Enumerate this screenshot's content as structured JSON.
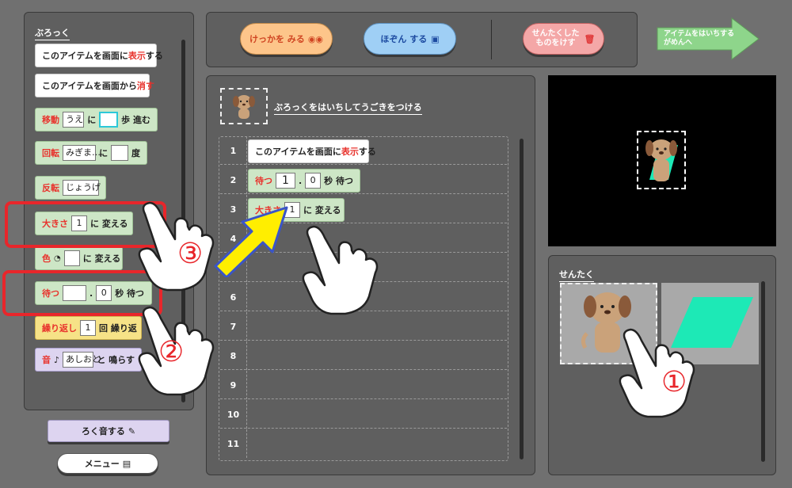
{
  "palette": {
    "label": "ぶろっく",
    "show_block": {
      "pre": "このアイテムを画面に",
      "accent": "表示",
      "post": "する"
    },
    "hide_block": {
      "pre": "このアイテムを画面から",
      "accent": "消す"
    },
    "move_block": {
      "accent": "移動",
      "dir": "うえ",
      "p1": "に",
      "value": "",
      "p2": "歩 進む"
    },
    "rotate_block": {
      "accent": "回転",
      "dir": "みぎま…",
      "p1": "に",
      "value": "",
      "p2": "度"
    },
    "flip_block": {
      "accent": "反転",
      "dir": "じょうげ"
    },
    "size_block": {
      "accent": "大きさ",
      "value": "1",
      "post": "に 変える"
    },
    "color_block": {
      "accent": "色",
      "post": "に 変える"
    },
    "wait_block": {
      "accent": "待つ",
      "v1": "",
      "dot": ".",
      "v2": "0",
      "post": "秒 待つ"
    },
    "repeat_block": {
      "accent": "繰り返し",
      "value": "1",
      "post": "回 繰り返"
    },
    "sound_block": {
      "accent": "音",
      "value": "あしおと",
      "post": "と 鳴らす"
    }
  },
  "bottom_left": {
    "record_label": "ろく音する",
    "menu_label": "メニュー"
  },
  "toolbar": {
    "view_result": "けっかを みる",
    "save": "ほぞん する",
    "delete_selected_l1": "せんたくした",
    "delete_selected_l2": "ものをけす",
    "place_item_l1": "アイテムをはいちする",
    "place_item_l2": "がめんへ"
  },
  "script_area": {
    "header": "ぶろっくをはいちしてうごきをつける",
    "rows": [
      "1",
      "2",
      "3",
      "4",
      "5",
      "6",
      "7",
      "8",
      "9",
      "10",
      "11"
    ],
    "row1": {
      "pre": "このアイテムを画面に",
      "accent": "表示",
      "post": "する"
    },
    "row2": {
      "accent": "待つ",
      "v1": "1",
      "dot": ".",
      "v2": "0",
      "post": "秒 待つ"
    },
    "row3": {
      "accent": "大きさ",
      "value": "1",
      "post": "に 変える"
    }
  },
  "selection": {
    "label": "せんたく"
  },
  "annotations": {
    "step1": "①",
    "step2": "②",
    "step3": "③"
  },
  "colors": {
    "accent_red": "#e8322c",
    "highlight_red": "#e8262b",
    "arrow_yellow": "#ffee00",
    "arrow_blue": "#3a55c7",
    "teal_shape": "#1de9b6"
  }
}
